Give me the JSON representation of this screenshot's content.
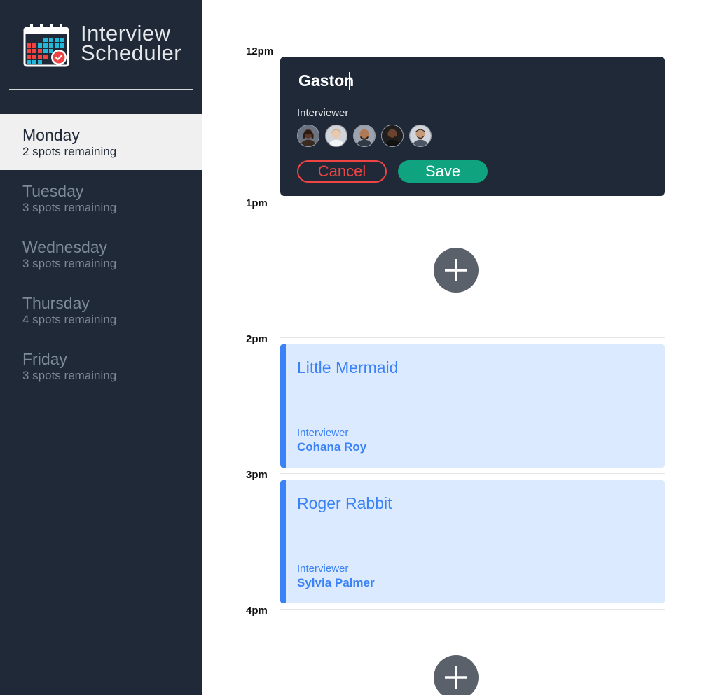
{
  "app": {
    "title_line1": "Interview",
    "title_line2": "Scheduler",
    "logo_icon": "calendar-check-icon"
  },
  "days": [
    {
      "name": "Monday",
      "spots": "2 spots remaining",
      "selected": true
    },
    {
      "name": "Tuesday",
      "spots": "3 spots remaining",
      "selected": false
    },
    {
      "name": "Wednesday",
      "spots": "3 spots remaining",
      "selected": false
    },
    {
      "name": "Thursday",
      "spots": "4 spots remaining",
      "selected": false
    },
    {
      "name": "Friday",
      "spots": "3 spots remaining",
      "selected": false
    }
  ],
  "times": [
    "12pm",
    "1pm",
    "2pm",
    "3pm",
    "4pm"
  ],
  "form": {
    "student_value": "Gaston",
    "interviewer_label": "Interviewer",
    "cancel_label": "Cancel",
    "save_label": "Save"
  },
  "appointments": [
    {
      "student": "Little Mermaid",
      "interviewer_label": "Interviewer",
      "interviewer": "Cohana Roy"
    },
    {
      "student": "Roger Rabbit",
      "interviewer_label": "Interviewer",
      "interviewer": "Sylvia Palmer"
    }
  ],
  "colors": {
    "sidebar": "#1f2937",
    "accent_blue": "#3b82f6",
    "appointment_bg": "#dbeafe",
    "save_green": "#10a37f",
    "cancel_red": "#ef4444"
  }
}
